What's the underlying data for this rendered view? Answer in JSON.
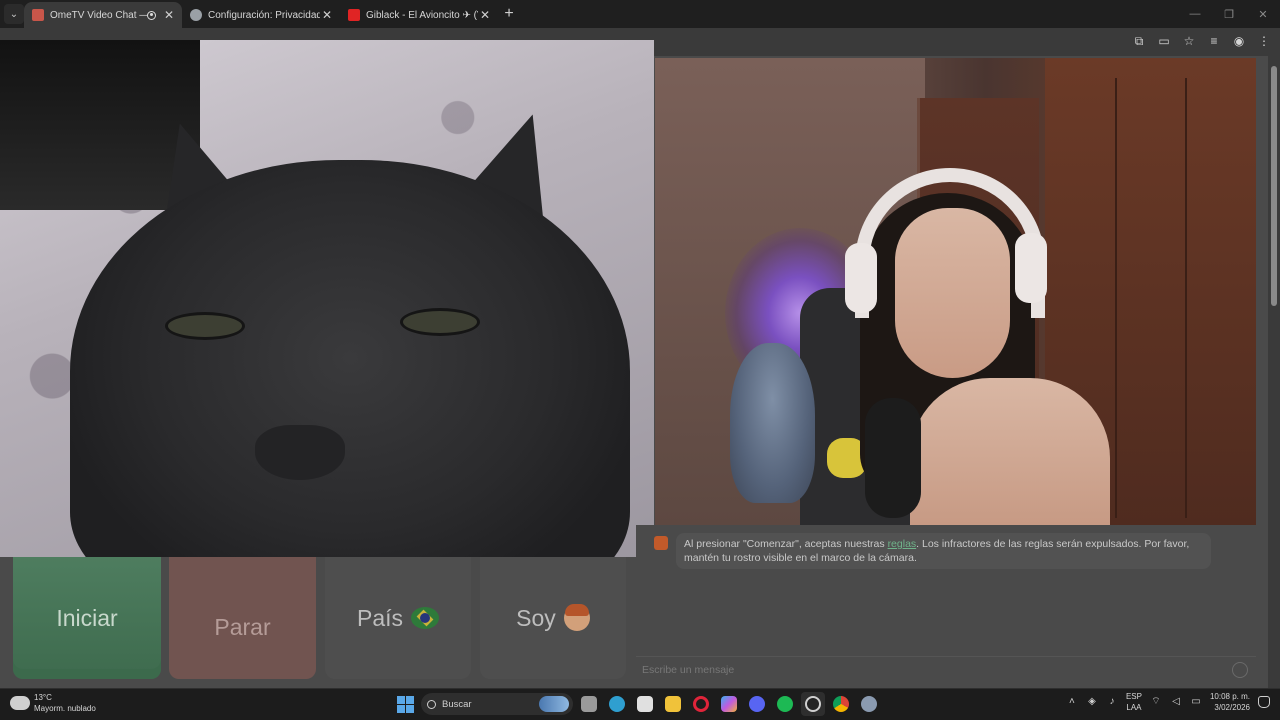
{
  "browser": {
    "tabs": [
      {
        "title": "OmeTV Video Chat — Ome",
        "favicon_color": "#c8564a",
        "active": true,
        "recording": true
      },
      {
        "title": "Configuración: Privacidad y seg",
        "favicon_color": "#9aa0a6",
        "active": false,
        "recording": false
      },
      {
        "title": "Giblack - El Avioncito ✈ (Vide",
        "favicon_color": "#e02424",
        "active": false,
        "recording": false
      }
    ],
    "new_tab": "+",
    "tab_menu": "⌄"
  },
  "controls": {
    "start_label": "Iniciar",
    "stop_label": "Parar",
    "country_label": "País",
    "gender_label": "Soy",
    "country_icon": "brazil-flag-icon",
    "gender_icon": "boy-emoji-icon"
  },
  "chat": {
    "message_prefix": "Al presionar \"Comenzar\", aceptas nuestras ",
    "rules_link": "reglas",
    "message_suffix": ". Los infractores de las reglas serán expulsados. Por favor, mantén tu rostro visible en el marco de la cámara.",
    "input_placeholder": "Escribe un mensaje"
  },
  "taskbar": {
    "weather_temp": "13°C",
    "weather_desc": "Mayorm. nublado",
    "search_placeholder": "Buscar",
    "lang_line1": "ESP",
    "lang_line2": "LAA",
    "time": "10:08 p. m.",
    "date": "3/02/2026",
    "apps": [
      {
        "name": "task-view",
        "color": "#9a9a9a"
      },
      {
        "name": "edge",
        "color": "#2f9fd0"
      },
      {
        "name": "store",
        "color": "#e0e0e0"
      },
      {
        "name": "file-explorer",
        "color": "#f0c23a"
      },
      {
        "name": "opera",
        "color": "#e0243a"
      },
      {
        "name": "copilot",
        "color": "#7f6fe0"
      },
      {
        "name": "discord",
        "color": "#5865f2"
      },
      {
        "name": "spotify",
        "color": "#1db954"
      },
      {
        "name": "obs",
        "color": "#3a3a3a"
      },
      {
        "name": "chrome",
        "color": "#e8a23a"
      },
      {
        "name": "settings",
        "color": "#8a9ab0"
      }
    ]
  }
}
